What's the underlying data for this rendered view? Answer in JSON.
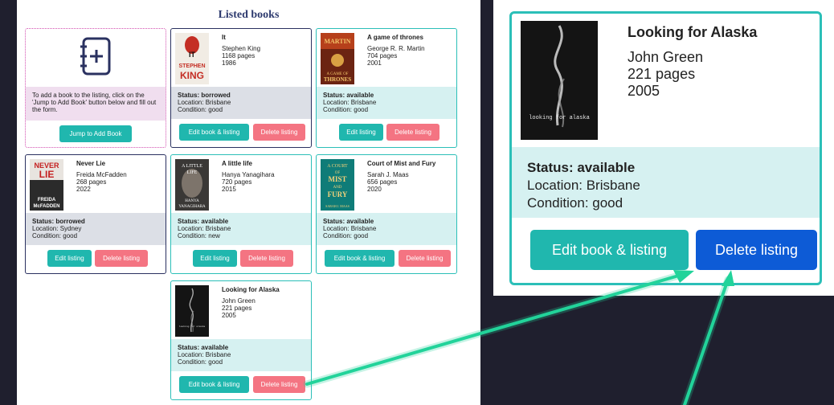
{
  "page_title": "Listed books",
  "add_card": {
    "instructions": "To add a book to the listing, click on the 'Jump to Add Book' button below and fill out the form.",
    "button": "Jump to Add Book"
  },
  "books": [
    {
      "title": "It",
      "author": "Stephen King",
      "pages": "1168 pages",
      "year": "1986",
      "status": "Status: borrowed",
      "location": "Location: Brisbane",
      "condition": "Condition: good",
      "edit": "Edit book & listing",
      "delete": "Delete listing",
      "cover_text": [
        "IT",
        "STEPHEN",
        "KING"
      ]
    },
    {
      "title": "A game of thrones",
      "author": "George R. R. Martin",
      "pages": "704 pages",
      "year": "2001",
      "status": "Status: available",
      "location": "Location: Brisbane",
      "condition": "Condition: good",
      "edit": "Edit listing",
      "delete": "Delete listing",
      "cover_text": [
        "MARTIN",
        "A GAME OF",
        "THRONES"
      ]
    },
    {
      "title": "Never Lie",
      "author": "Freida McFadden",
      "pages": "268 pages",
      "year": "2022",
      "status": "Status: borrowed",
      "location": "Location: Sydney",
      "condition": "Condition: good",
      "edit": "Edit listing",
      "delete": "Delete listing",
      "cover_text": [
        "NEVER",
        "LIE",
        "FREIDA",
        "McFADDEN"
      ]
    },
    {
      "title": "A little life",
      "author": "Hanya Yanagihara",
      "pages": "720 pages",
      "year": "2015",
      "status": "Status: available",
      "location": "Location: Brisbane",
      "condition": "Condition: new",
      "edit": "Edit listing",
      "delete": "Delete listing",
      "cover_text": [
        "A LITTLE",
        "LIFE",
        "HANYA",
        "YANAGIHARA"
      ]
    },
    {
      "title": "Court of Mist and Fury",
      "author": "Sarah J. Maas",
      "pages": "656 pages",
      "year": "2020",
      "status": "Status: available",
      "location": "Location: Brisbane",
      "condition": "Condition: good",
      "edit": "Edit book & listing",
      "delete": "Delete listing",
      "cover_text": [
        "A COURT",
        "OF",
        "MIST",
        "AND",
        "FURY",
        "SARAH J. MAAS"
      ]
    },
    {
      "title": "Looking for Alaska",
      "author": "John Green",
      "pages": "221 pages",
      "year": "2005",
      "status": "Status: available",
      "location": "Location: Brisbane",
      "condition": "Condition: good",
      "edit": "Edit book & listing",
      "delete": "Delete listing",
      "cover_text": [
        "looking for alaska"
      ]
    }
  ],
  "zoom": {
    "title": "Looking for Alaska",
    "author": "John Green",
    "pages": "221 pages",
    "year": "2005",
    "status": "Status: available",
    "location": "Location: Brisbane",
    "condition": "Condition: good",
    "edit": "Edit book & listing",
    "delete": "Delete listing",
    "cover_text": "looking for alaska"
  },
  "colors": {
    "teal": "#20b7ae",
    "delete_pink": "#f47482",
    "delete_blue": "#0d5bd6",
    "arrow": "#22d39a",
    "navy": "#2a3160"
  }
}
